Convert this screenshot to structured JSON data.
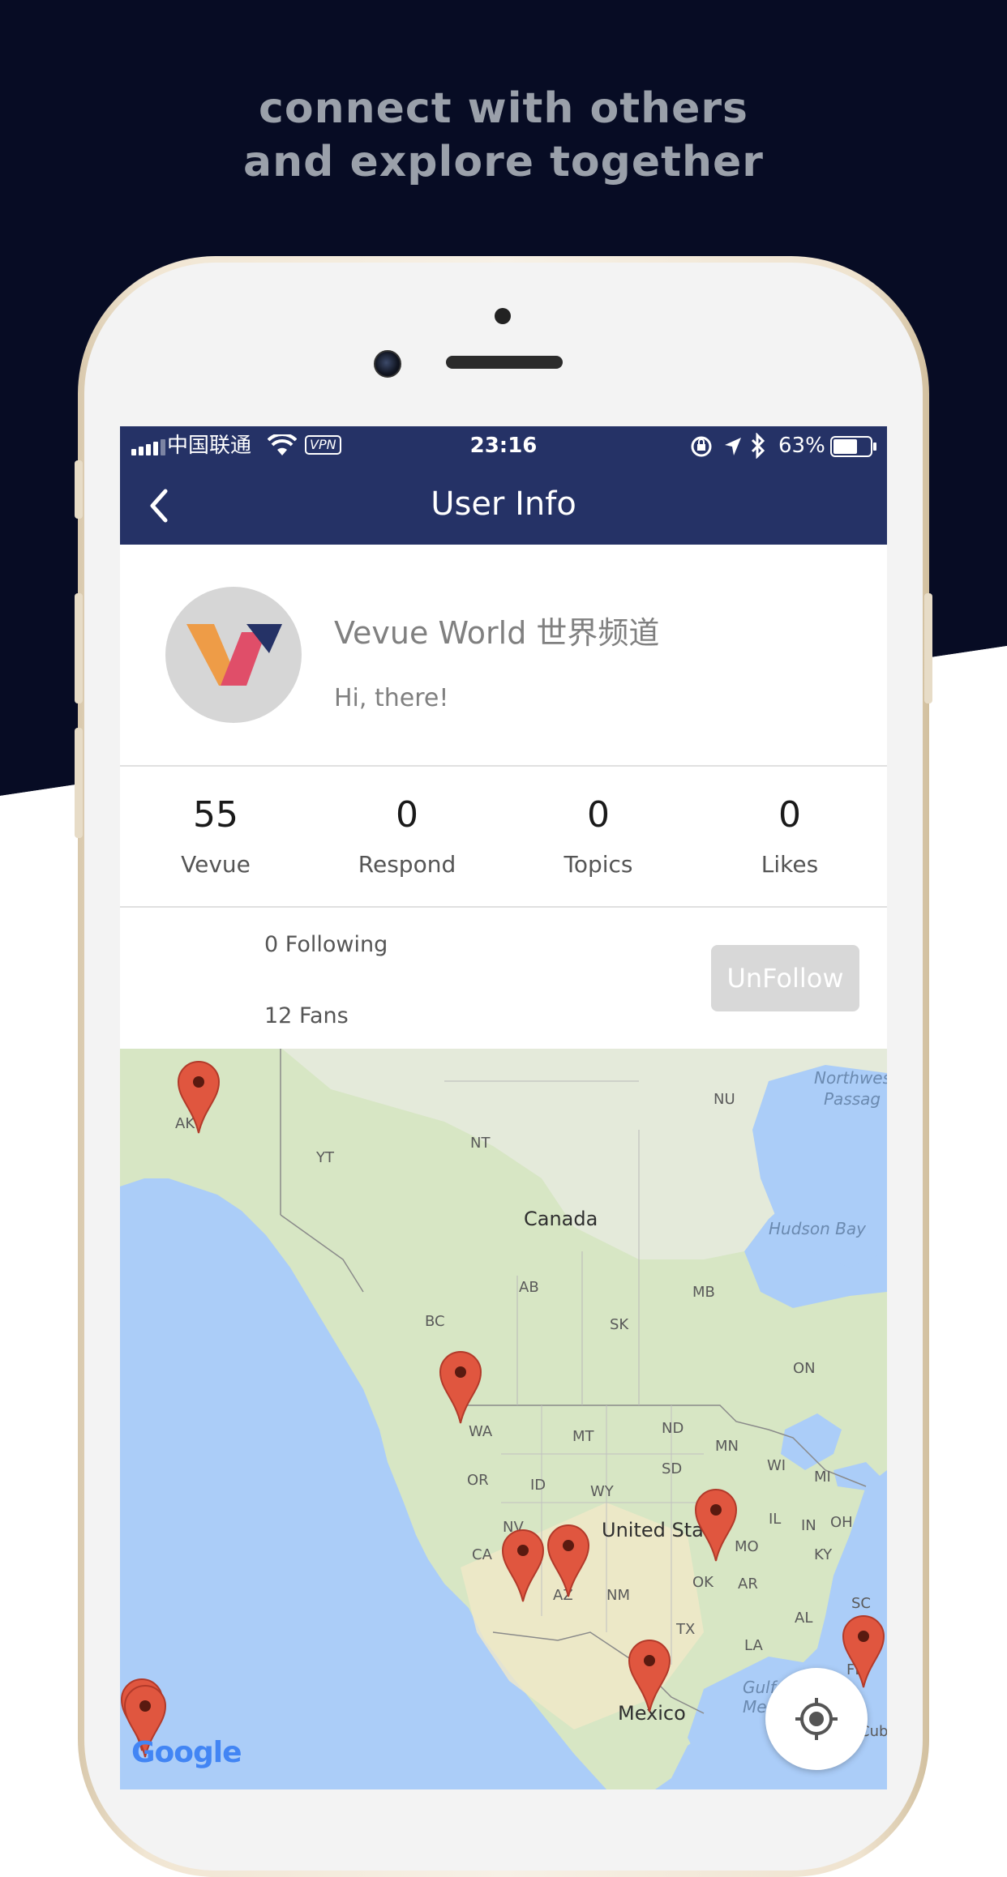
{
  "promo": {
    "line1": "connect with others",
    "line2": "and explore together"
  },
  "status_bar": {
    "carrier": "中国联通",
    "vpn": "VPN",
    "time": "23:16",
    "battery": "63%"
  },
  "nav": {
    "title": "User Info"
  },
  "profile": {
    "name": "Vevue World 世界频道",
    "bio": "Hi, there!"
  },
  "stats": [
    {
      "value": "55",
      "label": "Vevue"
    },
    {
      "value": "0",
      "label": "Respond"
    },
    {
      "value": "0",
      "label": "Topics"
    },
    {
      "value": "0",
      "label": "Likes"
    }
  ],
  "follow": {
    "following": "0 Following",
    "fans": "12 Fans",
    "button": "UnFollow"
  },
  "map": {
    "labels": {
      "nu": "NU",
      "yt": "YT",
      "nt": "NT",
      "canada": "Canada",
      "ab": "AB",
      "mb": "MB",
      "sk": "SK",
      "bc": "BC",
      "on": "ON",
      "wa": "WA",
      "mt": "MT",
      "nd": "ND",
      "mn": "MN",
      "sd": "SD",
      "wi": "WI",
      "mi": "MI",
      "or": "OR",
      "id": "ID",
      "wy": "WY",
      "united_states": "United State",
      "ca": "CA",
      "nv": "NV",
      "az": "AZ",
      "nm": "NM",
      "mo": "MO",
      "il": "IL",
      "in": "IN",
      "oh": "OH",
      "ky": "KY",
      "ok": "OK",
      "ar": "AR",
      "tx": "TX",
      "la": "LA",
      "al": "AL",
      "sc": "SC",
      "fl": "FL",
      "mexico": "Mexico",
      "ak": "AK",
      "cub": "Cub"
    },
    "water": {
      "northwest_1": "Northwes",
      "northwest_2": "Passag",
      "hudson": "Hudson Bay",
      "gulf_1": "Gulf",
      "gulf_2": "Me"
    },
    "attribution": "Google"
  },
  "colors": {
    "navy": "#253266",
    "dark_bg": "#070c24",
    "pin": "#e0563f",
    "button_disabled": "#d8d8d8"
  }
}
